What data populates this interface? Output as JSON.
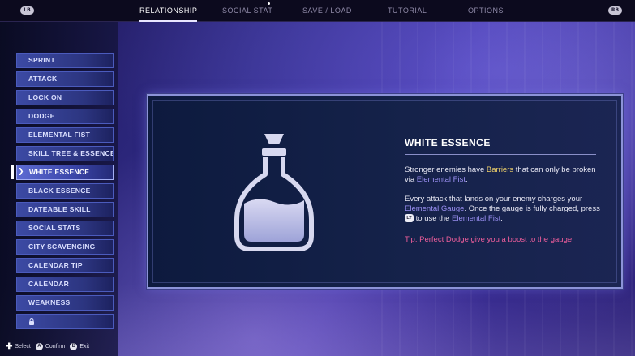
{
  "topbar": {
    "left_bumper": "LB",
    "right_bumper": "RB",
    "tabs": [
      {
        "label": "RELATIONSHIP",
        "active": true
      },
      {
        "label": "SOCIAL STAT",
        "active": false
      },
      {
        "label": "SAVE / LOAD",
        "active": false
      },
      {
        "label": "TUTORIAL",
        "active": false
      },
      {
        "label": "OPTIONS",
        "active": false
      }
    ]
  },
  "sidebar": {
    "items": [
      {
        "label": "SPRINT"
      },
      {
        "label": "ATTACK"
      },
      {
        "label": "LOCK ON"
      },
      {
        "label": "DODGE"
      },
      {
        "label": "ELEMENTAL FIST"
      },
      {
        "label": "SKILL TREE & ESSENCES"
      },
      {
        "label": "WHITE ESSENCE",
        "active": true
      },
      {
        "label": "BLACK ESSENCE"
      },
      {
        "label": "DATEABLE SKILL"
      },
      {
        "label": "SOCIAL STATS"
      },
      {
        "label": "CITY SCAVENGING"
      },
      {
        "label": "CALENDAR TIP"
      },
      {
        "label": "CALENDAR"
      },
      {
        "label": "WEAKNESS"
      }
    ],
    "locked_item_icon": "lock-icon"
  },
  "footer": {
    "select_label": "Select",
    "confirm_glyph": "A",
    "confirm_label": "Confirm",
    "exit_glyph": "B",
    "exit_label": "Exit"
  },
  "panel": {
    "title": "WHITE ESSENCE",
    "icon": "potion-bottle-icon",
    "p1_a": "Stronger enemies have ",
    "p1_b": "Barriers",
    "p1_c": " that can only be broken via ",
    "p1_d": "Elemental Fist",
    "p1_e": ".",
    "p2_a": "Every attack that lands on your enemy charges your ",
    "p2_b": "Elemental Gauge",
    "p2_c": ". Once the gauge is fully charged, press ",
    "p2_glyph": "LT",
    "p2_d": " to use the ",
    "p2_e": "Elemental Fist",
    "p2_f": ".",
    "tip": "Tip: Perfect Dodge give you a boost to the gauge."
  },
  "colors": {
    "highlight_gold": "#f2d36a",
    "highlight_blue": "#9a8ff2",
    "tip_pink": "#f05e9c"
  }
}
